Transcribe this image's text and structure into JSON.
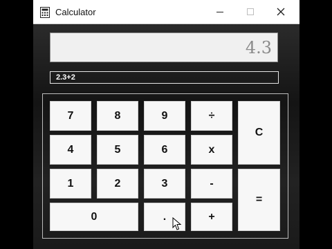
{
  "window": {
    "title": "Calculator",
    "icon": "calculator-icon",
    "controls": [
      "minimize-icon",
      "maximize-icon",
      "close-icon"
    ]
  },
  "display": {
    "value": "4.3"
  },
  "expression": {
    "text": "2.3+2"
  },
  "keys": {
    "seven": "7",
    "eight": "8",
    "nine": "9",
    "divide": "÷",
    "clear": "C",
    "four": "4",
    "five": "5",
    "six": "6",
    "multiply": "x",
    "one": "1",
    "two": "2",
    "three": "3",
    "minus": "-",
    "equals": "=",
    "zero": "0",
    "decimal": ".",
    "plus": "+"
  },
  "colors": {
    "titlebar": "#ffffff",
    "background": "#1b1b1b",
    "key_face": "#f7f7f7",
    "display_text": "#8a8a8a",
    "expression_text": "#ffffff"
  }
}
